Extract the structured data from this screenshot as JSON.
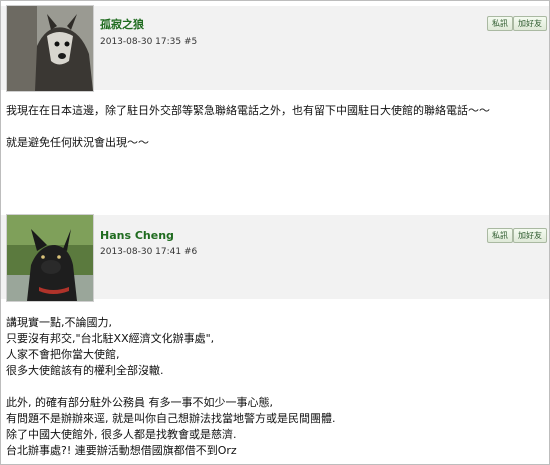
{
  "posts": [
    {
      "author": "孤寂之狼",
      "timestamp": "2013-08-30 17:35",
      "post_number": "#5",
      "buttons": {
        "pm": "私訊",
        "friend": "加好友"
      },
      "lines": [
        "我現在在日本這邊，除了駐日外交部等緊急聯絡電話之外，也有留下中國駐日大使館的聯絡電話～～",
        "",
        "就是避免任何狀況會出現～～"
      ]
    },
    {
      "author": "Hans Cheng",
      "timestamp": "2013-08-30 17:41",
      "post_number": "#6",
      "buttons": {
        "pm": "私訊",
        "friend": "加好友"
      },
      "lines": [
        "講現實一點,不論國力,",
        "只要沒有邦交,\"台北駐XX經濟文化辦事處\",",
        "人家不會把你當大使館,",
        "很多大使館該有的權利全部沒轍.",
        "",
        "此外, 的確有部分駐外公務員 有多一事不如少一事心態,",
        "有問題不是辦辦來逕, 就是叫你自己想辦法找當地警方或是民間團體.",
        "除了中國大使館外, 很多人都是找教會或是慈濟.",
        "台北辦事處?! 連要辦活動想借國旗都借不到Orz"
      ]
    }
  ]
}
